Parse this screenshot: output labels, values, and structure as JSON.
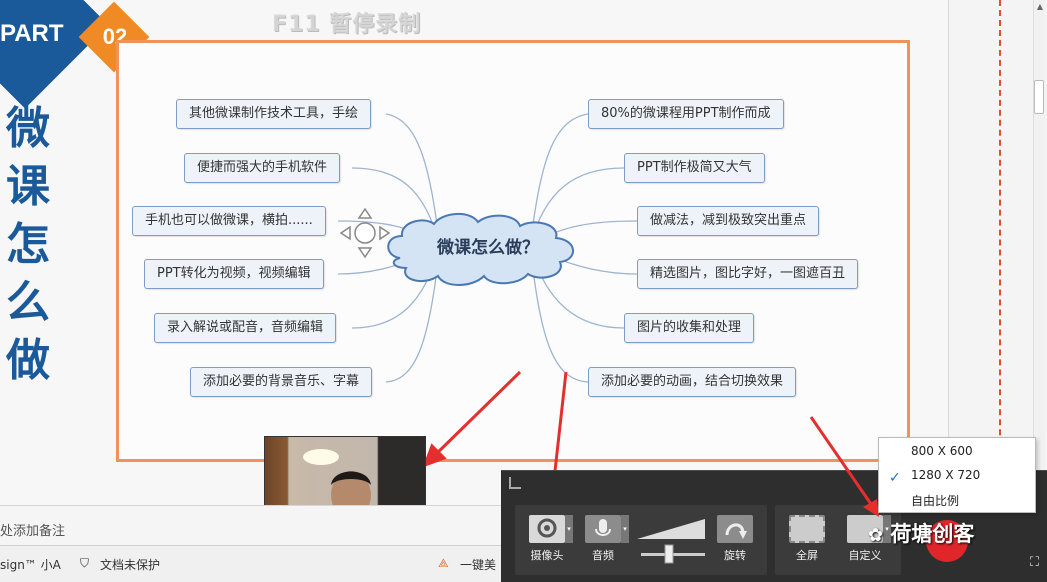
{
  "slide": {
    "part_label": "PART",
    "part_number": "02",
    "overlay_hint": "F11 暂停录制",
    "vertical_title": [
      "微",
      "课",
      "怎",
      "么",
      "做"
    ]
  },
  "mindmap": {
    "center": "微课怎么做？",
    "left_nodes": [
      "其他微课制作技术工具，手绘",
      "便捷而强大的手机软件",
      "手机也可以做微课，横拍......",
      "PPT转化为视频，视频编辑",
      "录入解说或配音，音频编辑",
      "添加必要的背景音乐、字幕"
    ],
    "right_nodes": [
      "80%的微课程用PPT制作而成",
      "PPT制作极简又大气",
      "做减法，减到极致突出重点",
      "精选图片，图比字好，一图遮百丑",
      "图片的收集和处理",
      "添加必要的动画，结合切换效果"
    ]
  },
  "notes": {
    "placeholder": "处添加备注"
  },
  "statusbar": {
    "design": "sign™ 小A",
    "doc_protect": "文档未保护",
    "beautify": "一键美"
  },
  "recorder": {
    "camera": "摄像头",
    "audio": "音频",
    "rotate": "旋转",
    "fullscreen": "全屏",
    "custom": "自定义"
  },
  "resolution_menu": {
    "options": [
      "800 X 600",
      "1280 X 720",
      "自由比例"
    ],
    "selected_index": 1
  },
  "brand": "荷塘创客",
  "colors": {
    "primary_blue": "#1b5a9a",
    "accent_orange": "#f08a24",
    "frame_orange": "#f1925a",
    "arrow_red": "#e3302e",
    "toolbar_bg": "#2e2e2e"
  }
}
